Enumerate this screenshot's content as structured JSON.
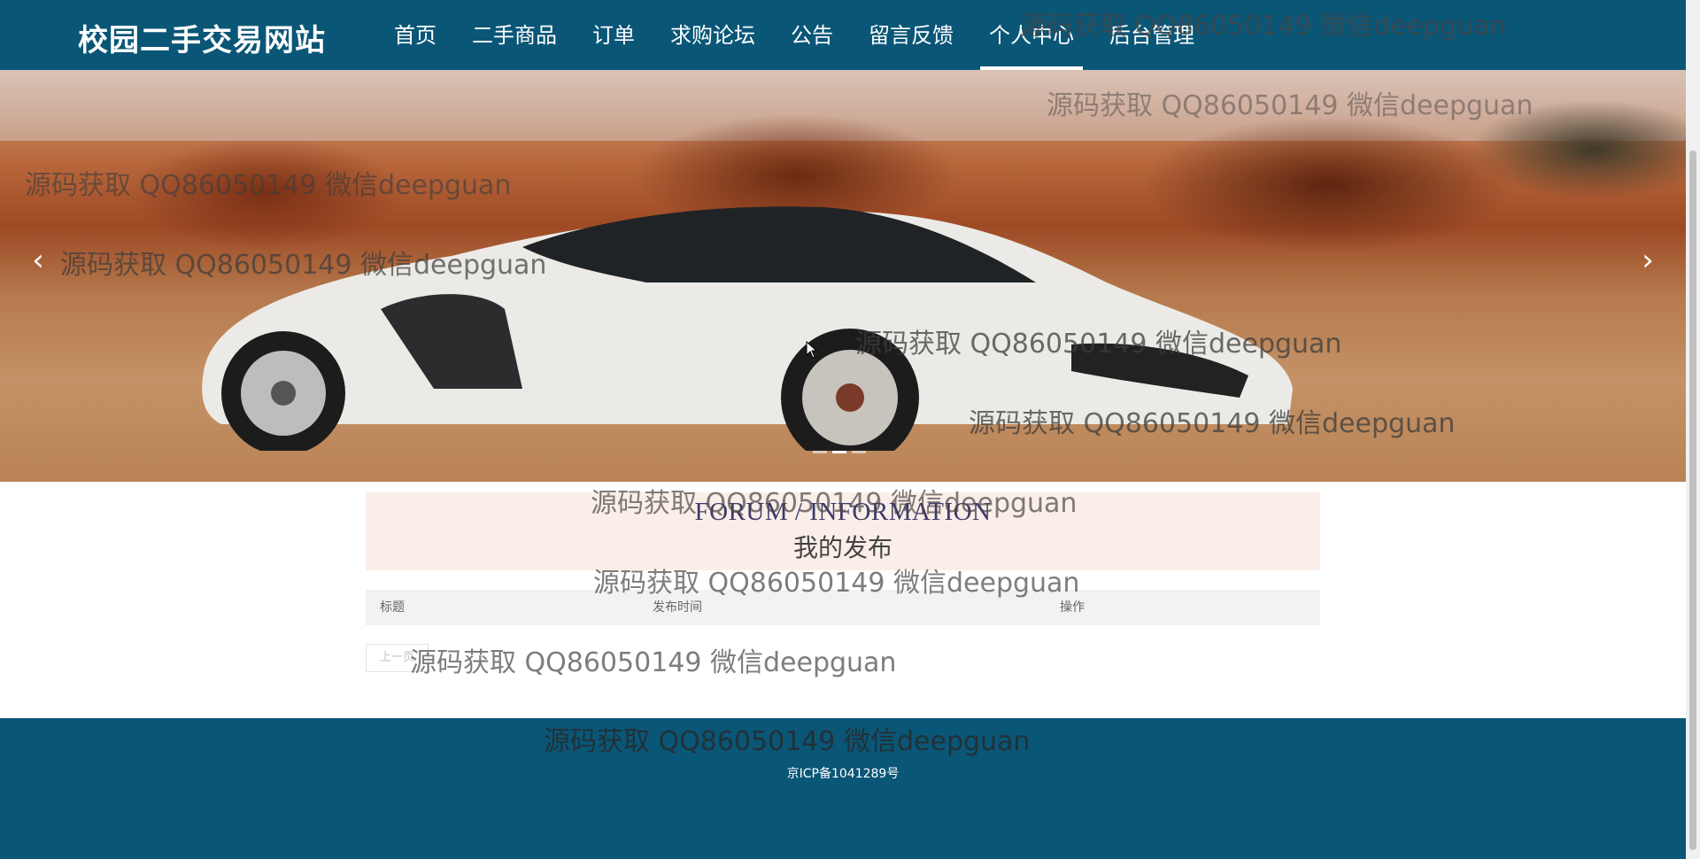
{
  "header": {
    "site_title": "校园二手交易网站",
    "nav": [
      {
        "label": "首页"
      },
      {
        "label": "二手商品"
      },
      {
        "label": "订单"
      },
      {
        "label": "求购论坛"
      },
      {
        "label": "公告"
      },
      {
        "label": "留言反馈"
      },
      {
        "label": "个人中心",
        "active": true
      },
      {
        "label": "后台管理"
      }
    ]
  },
  "carousel": {
    "prev_icon": "chevron-left-icon",
    "next_icon": "chevron-right-icon",
    "slide_count": 3,
    "active_slide": 1
  },
  "section": {
    "title_en": "FORUM / INFORMATION",
    "title_cn": "我的发布"
  },
  "table": {
    "columns": [
      "标题",
      "发布时间",
      "操作"
    ],
    "rows": []
  },
  "pager": {
    "prev_label": "上一页"
  },
  "footer": {
    "icp": "京ICP备1041289号"
  },
  "watermark": {
    "text": "源码获取 QQ86050149 微信deepguan"
  },
  "colors": {
    "header_bg": "#0a5677",
    "footer_bg": "#0a5677",
    "section_title_bg": "#fbeee8",
    "table_header_bg": "#f2f2f2"
  }
}
